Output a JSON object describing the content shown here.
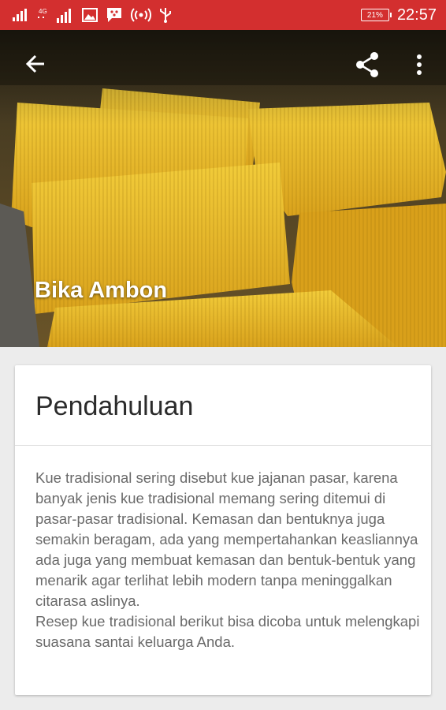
{
  "status_bar": {
    "time": "22:57",
    "battery": "21%",
    "network": "4G",
    "bg_color": "#d32f2f",
    "icons": [
      "signal-icon",
      "signal-4g-icon",
      "image-icon",
      "bbm-icon",
      "hotspot-icon",
      "usb-icon"
    ]
  },
  "toolbar": {
    "back_icon": "arrow-back-icon",
    "share_icon": "share-icon",
    "more_icon": "more-vert-icon"
  },
  "hero": {
    "title": "Bika Ambon"
  },
  "card": {
    "title": "Pendahuluan",
    "body_p1": "Kue tradisional sering disebut kue jajanan pasar, karena banyak jenis kue tradisional memang sering ditemui di pasar-pasar tradisional. Kemasan dan bentuknya juga semakin beragam, ada yang mempertahankan keasliannya ada juga yang membuat kemasan dan bentuk-bentuk yang menarik agar terlihat lebih modern tanpa meninggalkan citarasa aslinya.",
    "body_p2": "Resep kue tradisional berikut bisa dicoba untuk melengkapi suasana santai keluarga Anda."
  }
}
